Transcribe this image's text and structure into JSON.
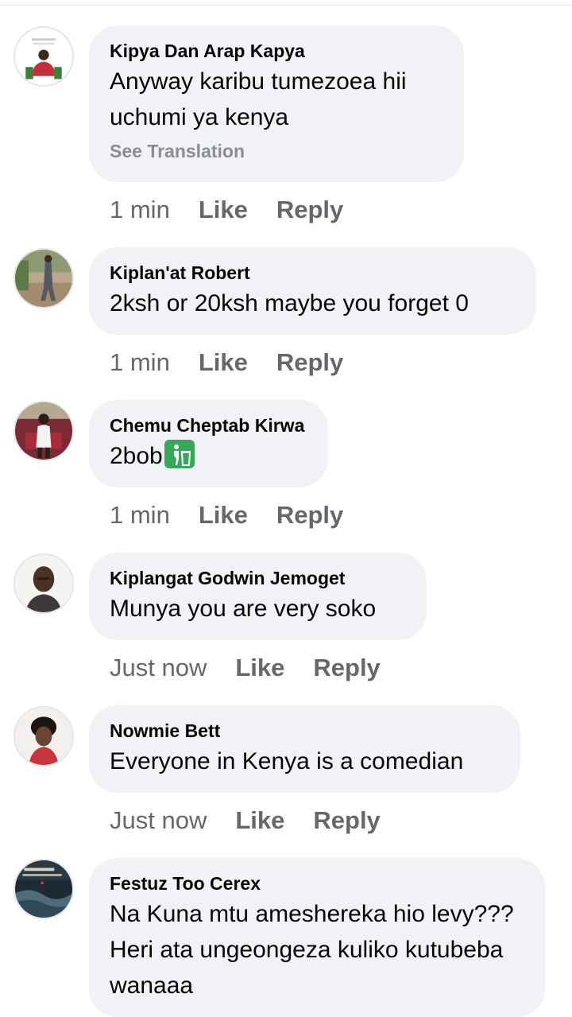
{
  "comments": [
    {
      "author": "Kipya Dan Arap Kapya",
      "text": "Anyway karibu tumezoea hii uchumi ya kenya",
      "see_translation": "See Translation",
      "time": "1 min",
      "like": "Like",
      "reply": "Reply"
    },
    {
      "author": "Kiplan'at Robert",
      "text": "2ksh or 20ksh maybe you forget 0",
      "time": "1 min",
      "like": "Like",
      "reply": "Reply"
    },
    {
      "author": "Chemu Cheptab Kirwa",
      "text": "2bob",
      "emoji": "put-litter-in-bin-emoji",
      "time": "1 min",
      "like": "Like",
      "reply": "Reply"
    },
    {
      "author": "Kiplangat Godwin Jemoget",
      "text": "Munya you are very soko",
      "time": "Just now",
      "like": "Like",
      "reply": "Reply"
    },
    {
      "author": "Nowmie Bett",
      "text": "Everyone in Kenya is a comedian",
      "time": "Just now",
      "like": "Like",
      "reply": "Reply"
    },
    {
      "author": "Festuz Too Cerex",
      "text": "Na Kuna mtu ameshereka hio levy??? Heri ata ungeongeza kuliko kutubeba wanaaa"
    }
  ],
  "colors": {
    "bubble": "#f0f2f5",
    "meta": "#65676b",
    "see_translation": "#8a8d91",
    "text": "#050505"
  }
}
